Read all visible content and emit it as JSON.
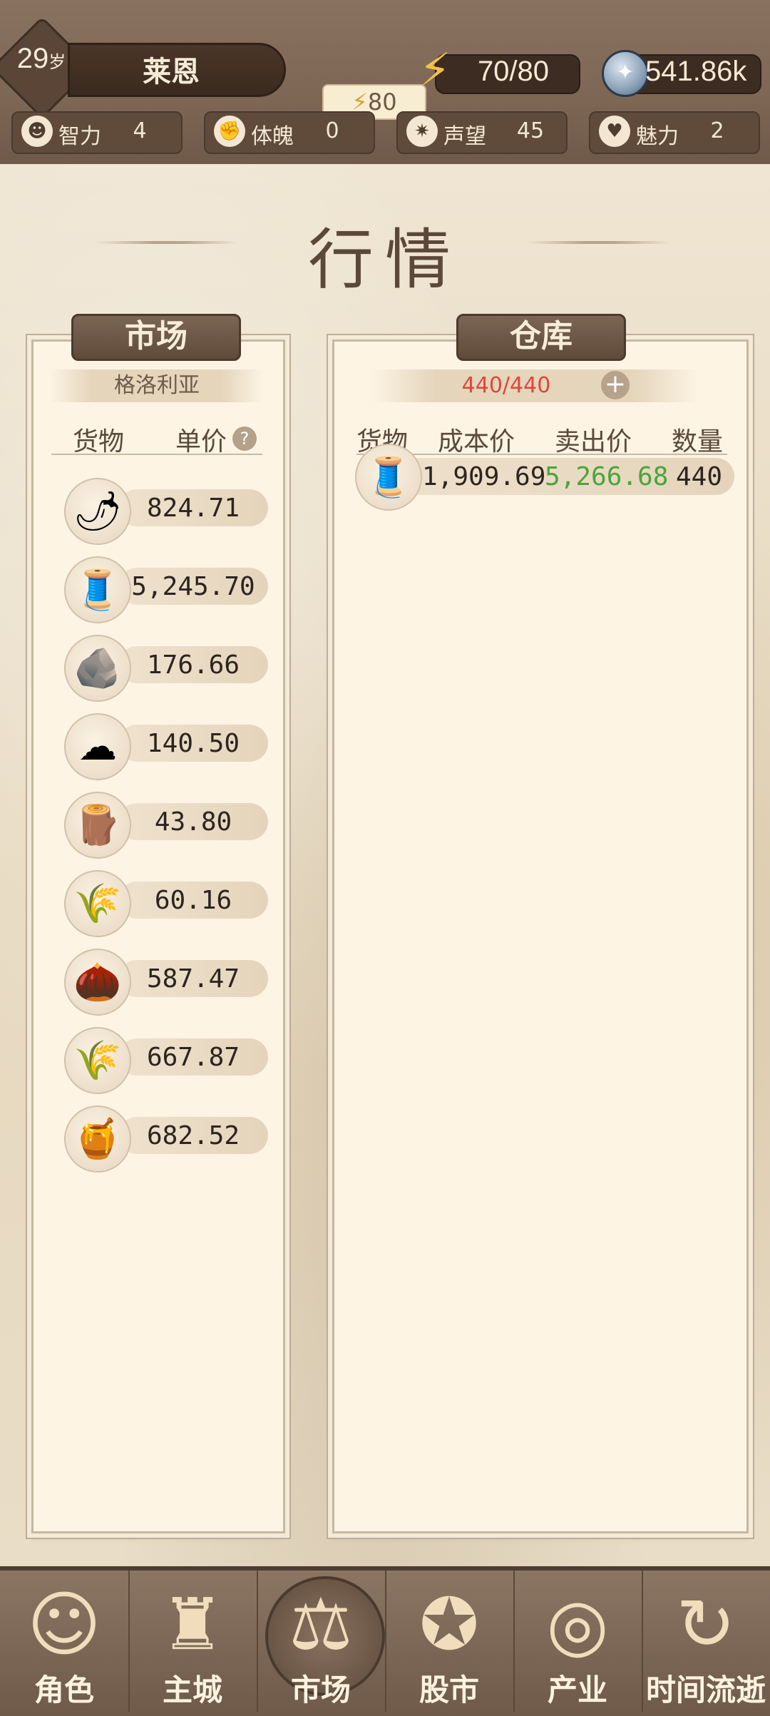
{
  "header": {
    "age": "29",
    "age_unit": "岁",
    "name": "莱恩",
    "energy": "70/80",
    "energy_tip": "80",
    "coins": "541.86k",
    "stats": [
      {
        "label": "智力",
        "value": "4",
        "icon": "brain-icon"
      },
      {
        "label": "体魄",
        "value": "0",
        "icon": "muscle-icon"
      },
      {
        "label": "声望",
        "value": "45",
        "icon": "laurel-icon"
      },
      {
        "label": "魅力",
        "value": "2",
        "icon": "heart-icon"
      }
    ]
  },
  "title": "行情",
  "market": {
    "tab": "市场",
    "location": "格洛利亚",
    "col_goods": "货物",
    "col_price": "单价",
    "help": "?",
    "items": [
      {
        "icon": "spice-icon",
        "glyph": "🌶",
        "price": "824.71"
      },
      {
        "icon": "cloth-roll-icon",
        "glyph": "🧵",
        "price": "5,245.70"
      },
      {
        "icon": "ore-icon",
        "glyph": "🪨",
        "price": "176.66"
      },
      {
        "icon": "cotton-icon",
        "glyph": "☁",
        "price": "140.50"
      },
      {
        "icon": "wood-log-icon",
        "glyph": "🪵",
        "price": "43.80"
      },
      {
        "icon": "wheat-icon",
        "glyph": "🌾",
        "price": "60.16"
      },
      {
        "icon": "hops-icon",
        "glyph": "🌰",
        "price": "587.47"
      },
      {
        "icon": "grain-bundle-icon",
        "glyph": "🌾",
        "price": "667.87"
      },
      {
        "icon": "honey-icon",
        "glyph": "🍯",
        "price": "682.52"
      }
    ]
  },
  "warehouse": {
    "tab": "仓库",
    "capacity": "440/440",
    "col_goods": "货物",
    "col_cost": "成本价",
    "col_sell": "卖出价",
    "col_qty": "数量",
    "rows": [
      {
        "icon": "cloth-roll-icon",
        "glyph": "🧵",
        "cost": "1,909.69",
        "sell": "5,266.68",
        "qty": "440"
      }
    ]
  },
  "nav": [
    {
      "label": "角色",
      "icon": "character-icon",
      "glyph": "☺"
    },
    {
      "label": "主城",
      "icon": "castle-icon",
      "glyph": "♜"
    },
    {
      "label": "市场",
      "icon": "scales-icon",
      "glyph": "⚖"
    },
    {
      "label": "股市",
      "icon": "stock-icon",
      "glyph": "✪"
    },
    {
      "label": "产业",
      "icon": "coins-icon",
      "glyph": "◎"
    },
    {
      "label": "时间流逝",
      "icon": "refresh-icon",
      "glyph": "↻"
    }
  ],
  "colors": {
    "capacity_red": "#e0463a",
    "sell_green": "#4aa53a"
  }
}
